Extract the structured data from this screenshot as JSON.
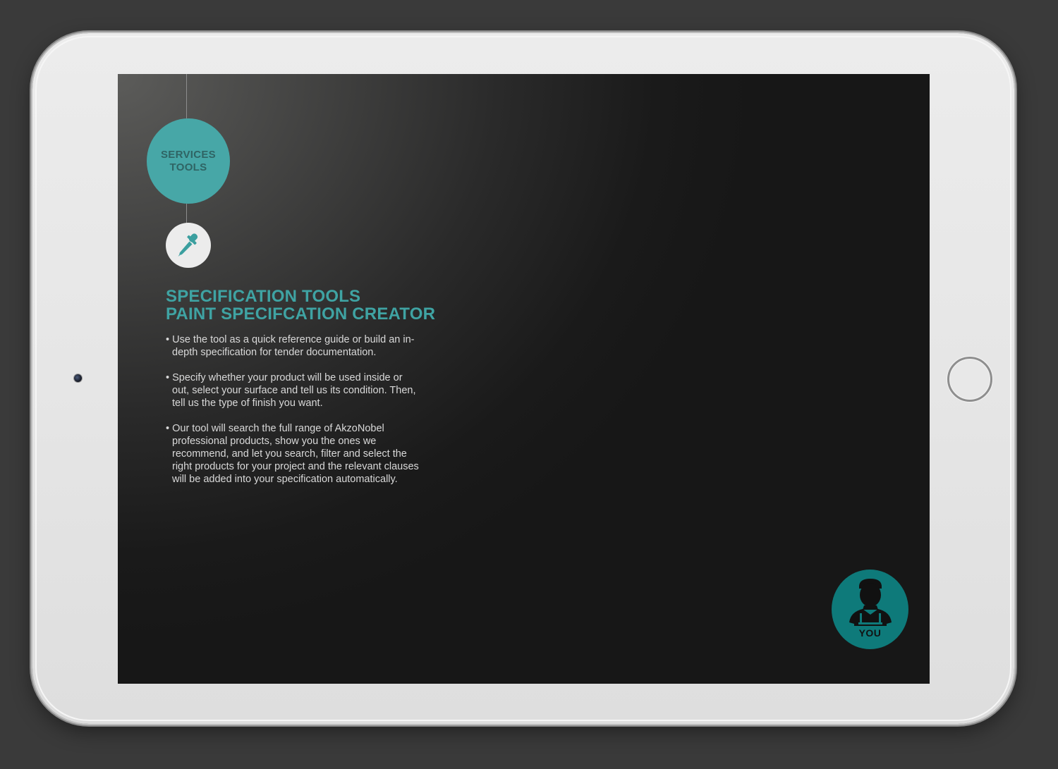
{
  "services_badge": {
    "line1": "SERVICES",
    "line2": "TOOLS"
  },
  "tool_icon": "pipette-icon",
  "heading": {
    "line1": "SPECIFICATION TOOLS",
    "line2": "PAINT SPECIFCATION CREATOR"
  },
  "bullets": [
    "• Use the tool as a quick reference guide or build an in-depth specification for tender documentation.",
    "• Specify whether your product will be used inside or out, select your surface and tell us its condition. Then, tell us the type of finish you want.",
    "• Our tool will search the full range of AkzoNobel professional products, show you the ones we recommend, and let you search, filter and select the right products for your project and the relevant clauses will be added into your specification automatically."
  ],
  "you_button": {
    "label": "YOU",
    "icon": "worker-icon"
  },
  "colors": {
    "teal_accent": "#47a7a7",
    "teal_dark": "#0e7a7a",
    "heading_teal": "#3fa3a3"
  }
}
